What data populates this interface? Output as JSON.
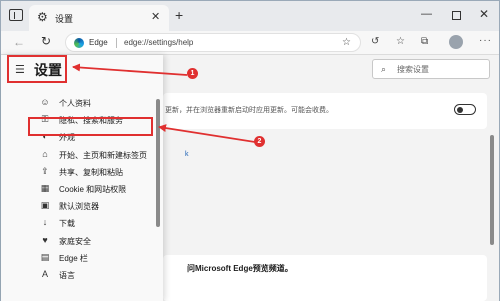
{
  "titlebar": {
    "tab_title": "设置",
    "icons": {
      "tab_actions": "tab-actions-icon",
      "gear": "gear-icon",
      "close": "close-icon",
      "new_tab": "plus-icon"
    }
  },
  "toolbar": {
    "site_label": "Edge",
    "url": "edge://settings/help",
    "icons": [
      "back-icon",
      "reload-icon",
      "favorite-add-icon",
      "extensions-icon",
      "favorites-icon",
      "collections-icon",
      "profile-icon",
      "more-icon"
    ]
  },
  "panel": {
    "title": "设置",
    "items": [
      {
        "icon": "profile-icon",
        "label": "个人资料"
      },
      {
        "icon": "lock-icon",
        "label": "隐私、搜索和服务"
      },
      {
        "icon": "appearance-icon",
        "label": "外观"
      },
      {
        "icon": "home-icon",
        "label": "开始、主页和新建标签页"
      },
      {
        "icon": "share-icon",
        "label": "共享、复制和粘贴"
      },
      {
        "icon": "cookie-icon",
        "label": "Cookie 和网站权限"
      },
      {
        "icon": "browser-icon",
        "label": "默认浏览器"
      },
      {
        "icon": "download-icon",
        "label": "下载"
      },
      {
        "icon": "family-icon",
        "label": "家庭安全"
      },
      {
        "icon": "edge-bar-icon",
        "label": "Edge 栏"
      },
      {
        "icon": "language-icon",
        "label": "语言"
      }
    ],
    "highlighted_item": "隐私、搜索和服务"
  },
  "main": {
    "search_placeholder": "搜索设置",
    "update_text": "更新，并在浏览器重新启动时应用更新。可能会收费。",
    "toggle_on": false,
    "link_fragment": "k",
    "insider_text": "问Microsoft Edge预览频道。"
  },
  "annotations": {
    "badge1": "1",
    "badge2": "2"
  },
  "colors": {
    "annotation_red": "#e03030",
    "accent_blue": "#1a5fb4"
  }
}
